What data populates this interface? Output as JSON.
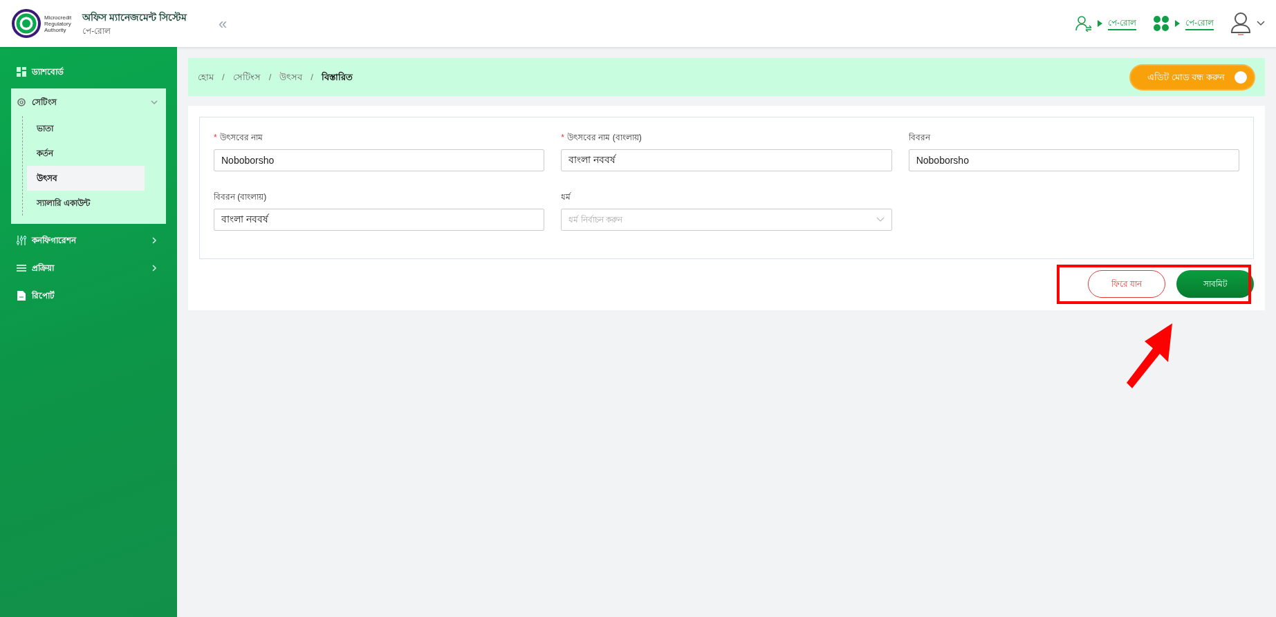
{
  "header": {
    "logo_lines": [
      "Microcredit",
      "Regulatory",
      "Authority"
    ],
    "title": "অফিস ম্যানেজমেন্ট সিস্টেম",
    "subtitle": "পে-রোল",
    "collapse": "«",
    "links": [
      {
        "kind": "user-switch",
        "label": "পে-রোল"
      },
      {
        "kind": "apps",
        "label": "পে-রোল"
      }
    ]
  },
  "sidebar": {
    "items": [
      {
        "kind": "grid",
        "label": "ড্যাশবোর্ড",
        "expandable": false,
        "expanded": false
      },
      {
        "kind": "gear",
        "label": "সেটিংস",
        "expandable": true,
        "expanded": true,
        "children": [
          {
            "label": "ভাতা",
            "selected": false
          },
          {
            "label": "কর্তন",
            "selected": false
          },
          {
            "label": "উৎসব",
            "selected": true
          },
          {
            "label": "স্যালারি একাউন্ট",
            "selected": false
          }
        ]
      },
      {
        "kind": "sliders",
        "label": "কনফিগারেশন",
        "expandable": true,
        "expanded": false
      },
      {
        "kind": "list",
        "label": "প্রক্রিয়া",
        "expandable": true,
        "expanded": false
      },
      {
        "kind": "file",
        "label": "রিপোর্ট",
        "expandable": false,
        "expanded": false
      }
    ]
  },
  "breadcrumb_separator": "/",
  "breadcrumb": [
    {
      "label": "হোম",
      "current": false
    },
    {
      "label": "সেটিংস",
      "current": false
    },
    {
      "label": "উৎসব",
      "current": false
    },
    {
      "label": "বিস্তারিত",
      "current": true
    }
  ],
  "edit_toggle": {
    "label": "এডিট মোড বন্ধ করুন",
    "on": true
  },
  "form": {
    "required_mark": "*",
    "fields": [
      {
        "kind": "text",
        "label": "উৎসবের নাম",
        "required": true,
        "value": "Noboborsho"
      },
      {
        "kind": "text",
        "label": "উৎসবের নাম (বাংলায়)",
        "required": true,
        "value": "বাংলা নববর্ষ"
      },
      {
        "kind": "text",
        "label": "বিবরন",
        "required": false,
        "value": "Noboborsho"
      },
      {
        "kind": "text",
        "label": "বিবরন (বাংলায়)",
        "required": false,
        "value": "বাংলা নববর্ষ"
      },
      {
        "kind": "select",
        "label": "ধর্ম",
        "required": false,
        "placeholder": "ধর্ম নির্বাচন করুন"
      }
    ]
  },
  "buttons": [
    {
      "kind": "outline",
      "label": "ফিরে যান"
    },
    {
      "kind": "primary",
      "label": "সাবমিট"
    }
  ]
}
